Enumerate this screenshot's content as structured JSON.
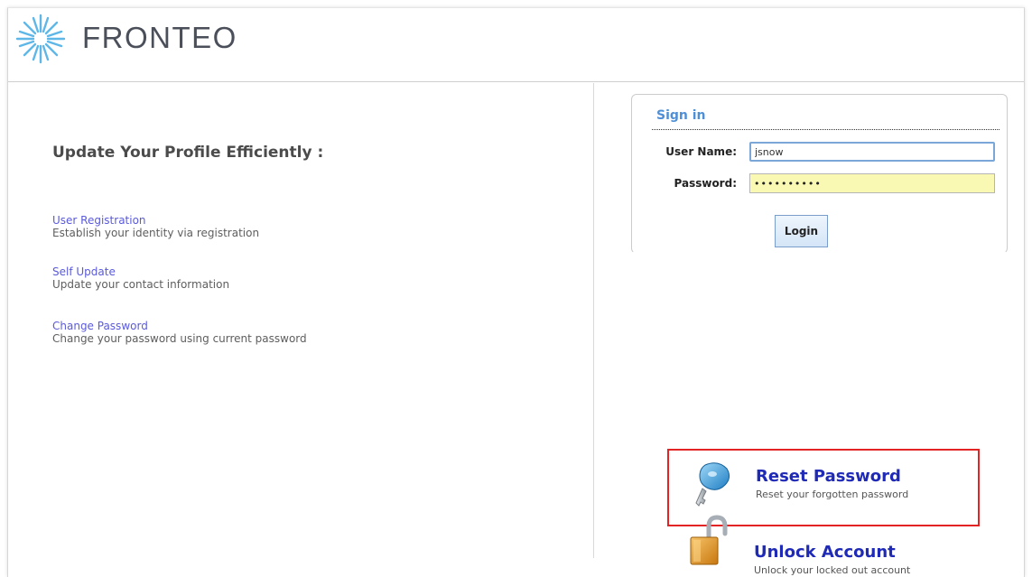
{
  "brand": {
    "name": "FRONTEO",
    "colors": {
      "burst": "#5fb7e8",
      "text": "#4a4f5a"
    }
  },
  "main": {
    "headline": "Update Your Profile Efficiently :",
    "links": [
      {
        "title": "User Registration",
        "description": "Establish your identity via registration"
      },
      {
        "title": "Self Update",
        "description": "Update your contact information"
      },
      {
        "title": "Change Password",
        "description": "Change your password using current password"
      }
    ]
  },
  "signin": {
    "title": "Sign in",
    "username_label": "User Name:",
    "username_value": "jsnow",
    "password_label": "Password:",
    "password_value": "••••••••••",
    "login_label": "Login"
  },
  "actions": {
    "reset": {
      "title": "Reset Password",
      "description": "Reset your forgotten password",
      "icon": "key-icon"
    },
    "unlock": {
      "title": "Unlock Account",
      "description": "Unlock your locked out account",
      "icon": "padlock-icon"
    }
  }
}
